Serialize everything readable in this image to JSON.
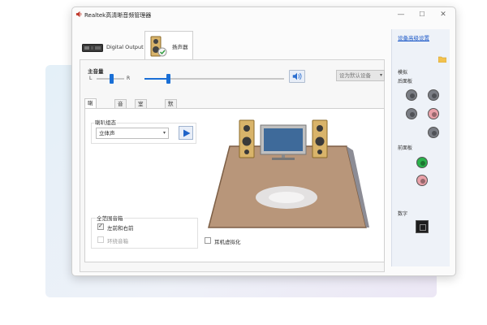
{
  "window": {
    "title": "Realtek高清晰音频管理器",
    "controls": {
      "minimize": "—",
      "maximize": "☐",
      "close": "✕"
    }
  },
  "device_tabs": [
    {
      "label": "Digital Output",
      "icon": "digital-output-icon",
      "active": false
    },
    {
      "label": "扬声器",
      "icon": "speaker-device-icon",
      "active": true
    }
  ],
  "volume": {
    "title": "主音量",
    "left_label": "L",
    "right_label": "R",
    "balance_level": 0.5,
    "volume_level": 0.17
  },
  "default_device": {
    "label": "设为默认设备",
    "arrow": "▾"
  },
  "sub_tabs": [
    {
      "label": "喇叭组态",
      "active": true
    },
    {
      "label": "音效",
      "active": false
    },
    {
      "label": "室内校正",
      "active": false
    },
    {
      "label": "默认格式",
      "active": false
    }
  ],
  "speaker_config": {
    "label": "喇叭组态",
    "selected": "立体声",
    "arrow": "▾"
  },
  "full_range": {
    "title": "全范围音箱",
    "options": [
      {
        "label": "左前和右前",
        "checked": true,
        "enabled": true
      },
      {
        "label": "环绕音箱",
        "checked": false,
        "enabled": false
      }
    ]
  },
  "headphone_virtualization": {
    "label": "耳机虚拟化",
    "checked": false
  },
  "right_panel": {
    "settings_link": "设备高级设置",
    "analog_label": "模拟",
    "back_panel_label": "后面板",
    "front_panel_label": "前面板",
    "digital_label": "数字",
    "back_jacks": [
      "#7a7d84",
      "#7a7d84",
      "#7a7d84",
      "#e8a0a8",
      "#7a7d84"
    ],
    "front_jacks": [
      "#2bb24c",
      "#e8a0a8"
    ]
  }
}
